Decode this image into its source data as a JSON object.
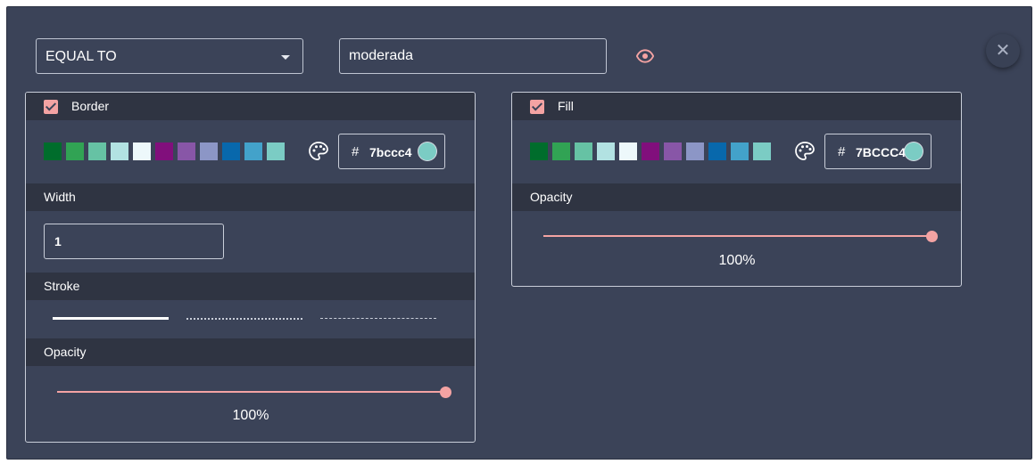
{
  "condition": {
    "operator": "EQUAL TO",
    "value": "moderada"
  },
  "icons": {
    "visibility": "eye-icon",
    "close": "close-icon",
    "palette": "palette-icon",
    "check": "check-icon"
  },
  "border": {
    "title": "Border",
    "enabled": true,
    "swatches": [
      "#006d2c",
      "#31a354",
      "#66c2a4",
      "#b2e2e2",
      "#edf8fb",
      "#810f7c",
      "#8856a7",
      "#8c96c6",
      "#0868ac",
      "#43a2ca",
      "#7bccc4"
    ],
    "hex_prefix": "#",
    "hex_value": "7bccc4",
    "selected_color": "#7bccc4",
    "width_label": "Width",
    "width_value": "1",
    "stroke_label": "Stroke",
    "strokes": [
      "solid",
      "dotted",
      "dashed"
    ],
    "opacity_label": "Opacity",
    "opacity_percent": 100,
    "opacity_text": "100%"
  },
  "fill": {
    "title": "Fill",
    "enabled": true,
    "swatches": [
      "#006d2c",
      "#31a354",
      "#66c2a4",
      "#b2e2e2",
      "#edf8fb",
      "#810f7c",
      "#8856a7",
      "#8c96c6",
      "#0868ac",
      "#43a2ca",
      "#7bccc4"
    ],
    "hex_prefix": "#",
    "hex_value": "7BCCC4",
    "selected_color": "#7bccc4",
    "opacity_label": "Opacity",
    "opacity_percent": 100,
    "opacity_text": "100%"
  },
  "colors": {
    "background": "#3b4358",
    "header": "#2f3442",
    "accent": "#f4a3a3"
  }
}
